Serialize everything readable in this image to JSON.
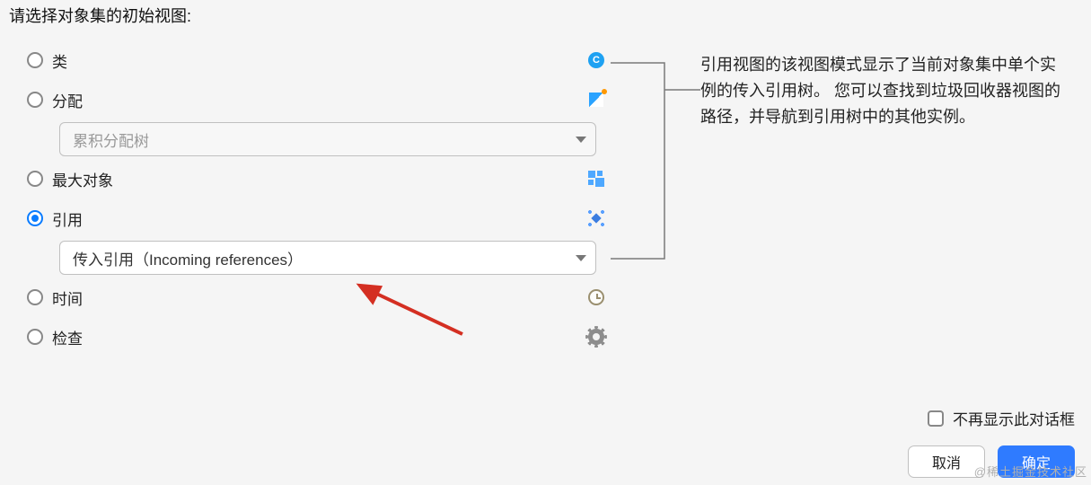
{
  "prompt": "请选择对象集的初始视图:",
  "options": {
    "class_": "类",
    "allocation": "分配",
    "allocation_tree": "累积分配树",
    "biggest": "最大对象",
    "reference": "引用",
    "reference_mode": "传入引用（Incoming references）",
    "time": "时间",
    "inspection": "检查"
  },
  "selected": "reference",
  "description": "引用视图的该视图模式显示了当前对象集中单个实例的传入引用树。 您可以查找到垃圾回收器视图的路径，并导航到引用树中的其他实例。",
  "checkbox_label": "不再显示此对话框",
  "buttons": {
    "cancel": "取消",
    "ok": "确定"
  },
  "watermark": "@稀土掘金技术社区",
  "icons": {
    "class_": "class-icon",
    "allocation": "allocation-icon",
    "biggest": "biggest-objects-icon",
    "reference": "reference-icon",
    "time": "clock-icon",
    "inspection": "gear-icon"
  }
}
